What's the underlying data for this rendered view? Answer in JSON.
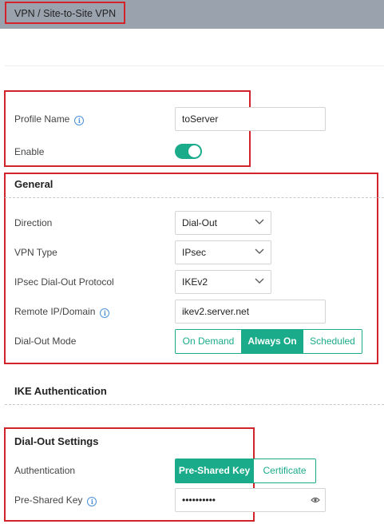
{
  "breadcrumb": "VPN / Site-to-Site VPN",
  "profile": {
    "name_label": "Profile Name",
    "name_value": "toServer",
    "enable_label": "Enable",
    "enabled": true
  },
  "general": {
    "title": "General",
    "direction_label": "Direction",
    "direction_value": "Dial-Out",
    "vpn_type_label": "VPN Type",
    "vpn_type_value": "IPsec",
    "protocol_label": "IPsec Dial-Out Protocol",
    "protocol_value": "IKEv2",
    "remote_label": "Remote IP/Domain",
    "remote_value": "ikev2.server.net",
    "mode_label": "Dial-Out Mode",
    "mode_options": [
      "On Demand",
      "Always On",
      "Scheduled"
    ],
    "mode_selected": "Always On"
  },
  "ike": {
    "title": "IKE Authentication"
  },
  "dialout": {
    "title": "Dial-Out Settings",
    "auth_label": "Authentication",
    "auth_options": [
      "Pre-Shared Key",
      "Certificate"
    ],
    "auth_selected": "Pre-Shared Key",
    "psk_label": "Pre-Shared Key",
    "psk_value": "••••••••••"
  },
  "colors": {
    "accent": "#1aab8a",
    "highlight": "#d2232a",
    "info": "#4a90d9",
    "topbar": "#9aa3ad"
  },
  "icons": [
    "info-icon",
    "chevron-down-icon",
    "eye-icon"
  ]
}
